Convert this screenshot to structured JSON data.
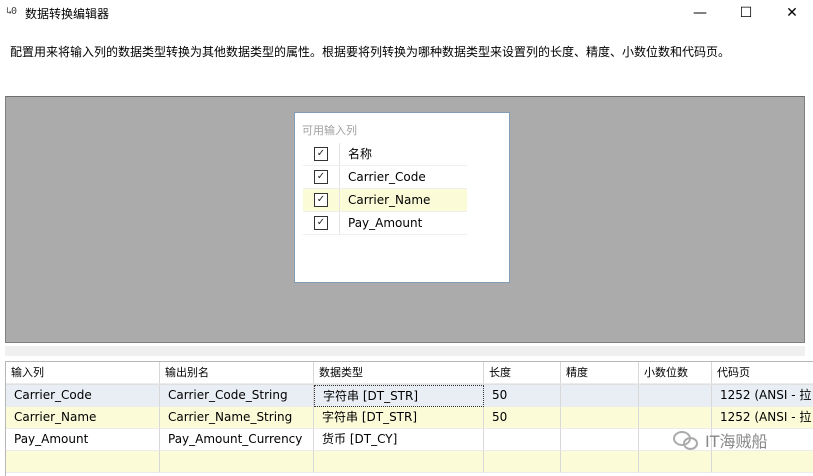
{
  "window": {
    "icon_text": "↳0",
    "title": "数据转换编辑器",
    "minimize": "—",
    "maximize": "☐",
    "close": "✕"
  },
  "description": "配置用来将输入列的数据类型转换为其他数据类型的属性。根据要将列转换为哪种数据类型来设置列的长度、精度、小数位数和代码页。",
  "available_columns": {
    "title": "可用输入列",
    "header": "名称",
    "rows": [
      {
        "name": "Carrier_Code",
        "checked": true
      },
      {
        "name": "Carrier_Name",
        "checked": true
      },
      {
        "name": "Pay_Amount",
        "checked": true
      }
    ]
  },
  "grid": {
    "columns": [
      "输入列",
      "输出别名",
      "数据类型",
      "长度",
      "精度",
      "小数位数",
      "代码页"
    ],
    "rows": [
      [
        "Carrier_Code",
        "Carrier_Code_String",
        "字符串 [DT_STR]",
        "50",
        "",
        "",
        "1252  (ANSI - 拉"
      ],
      [
        "Carrier_Name",
        "Carrier_Name_String",
        "字符串 [DT_STR]",
        "50",
        "",
        "",
        "1252  (ANSI - 拉"
      ],
      [
        "Pay_Amount",
        "Pay_Amount_Currency",
        "货币 [DT_CY]",
        "",
        "",
        "",
        ""
      ]
    ]
  },
  "watermark": "IT海贼船"
}
